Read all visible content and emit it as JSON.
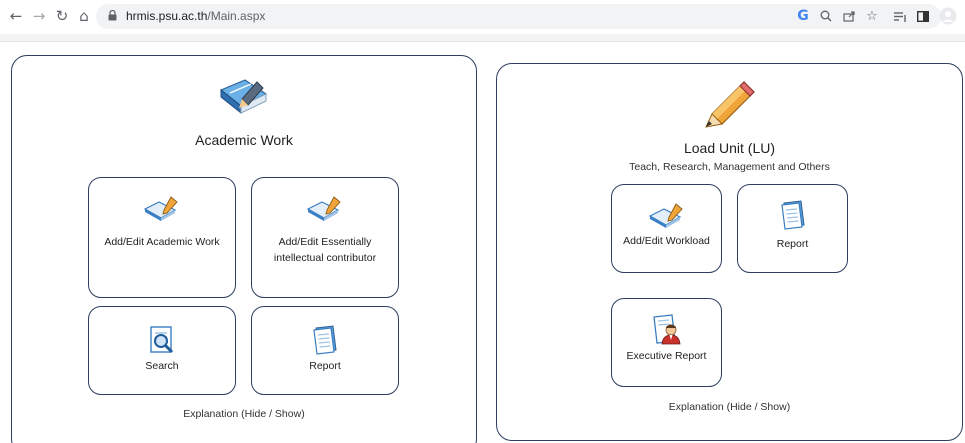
{
  "browser": {
    "url_host": "hrmis.psu.ac.th",
    "url_path": "/Main.aspx"
  },
  "left_panel": {
    "title": "Academic Work",
    "cards": {
      "add_edit_academic": "Add/Edit Academic Work",
      "add_edit_essential": "Add/Edit Essentially intellectual contributor",
      "search": "Search",
      "report": "Report"
    },
    "explanation": "Explanation (Hide / Show)"
  },
  "right_panel": {
    "title": "Load Unit (LU)",
    "subtitle": "Teach, Research, Management and Others",
    "cards": {
      "add_edit_workload": "Add/Edit Workload",
      "report": "Report",
      "executive_report": "Executive Report"
    },
    "explanation": "Explanation (Hide / Show)"
  },
  "colors": {
    "panel_border": "#2d3e5e",
    "book_blue": "#3a7fc4",
    "pencil_orange": "#f0a53a"
  }
}
